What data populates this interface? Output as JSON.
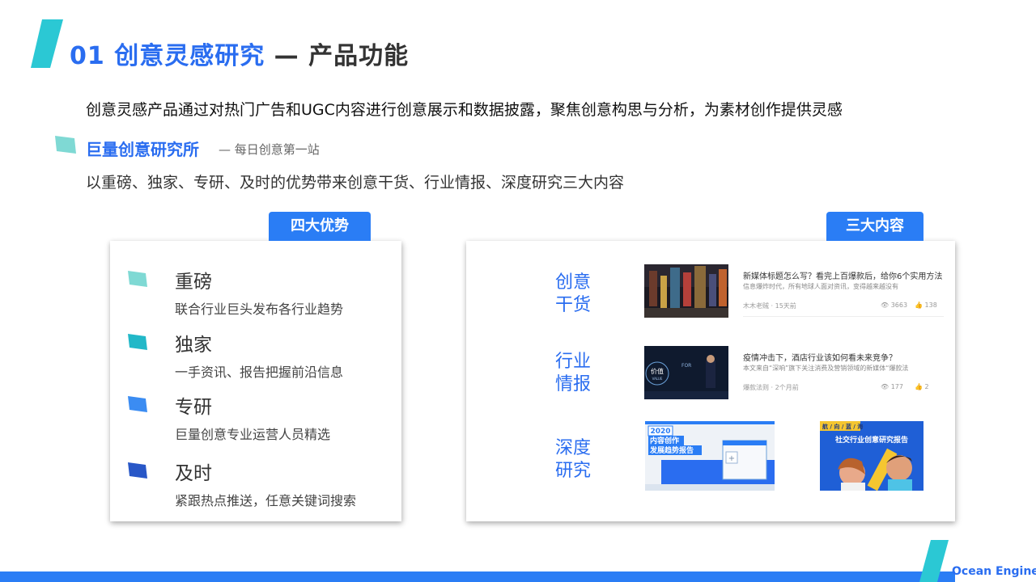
{
  "header": {
    "title_number": "01 创意灵感研究",
    "title_rest": " — 产品功能"
  },
  "intro": "创意灵感产品通过对热门广告和UGC内容进行创意展示和数据披露，聚焦创意构思与分析，为素材创作提供灵感",
  "lab": {
    "name": "巨量创意研究所",
    "tagline": "— 每日创意第一站",
    "description": "以重磅、独家、专研、及时的优势带来创意干货、行业情报、深度研究三大内容"
  },
  "advantages": {
    "tab": "四大优势",
    "items": [
      {
        "name": "重磅",
        "desc": "联合行业巨头发布各行业趋势",
        "color": "#7fd9d4"
      },
      {
        "name": "独家",
        "desc": "一手资讯、报告把握前沿信息",
        "color": "#22b8c8"
      },
      {
        "name": "专研",
        "desc": "巨量创意专业运营人员精选",
        "color": "#3b8cf2"
      },
      {
        "name": "及时",
        "desc": "紧跟热点推送，任意关键词搜索",
        "color": "#2857c7"
      }
    ]
  },
  "contents": {
    "tab": "三大内容",
    "categories": [
      {
        "line1": "创意",
        "line2": "干货"
      },
      {
        "line1": "行业",
        "line2": "情报"
      },
      {
        "line1": "深度",
        "line2": "研究"
      }
    ],
    "articles": [
      {
        "title": "新媒体标题怎么写？看完上百爆款后，给你6个实用方法",
        "snippet": "信息爆炸时代，所有地球人面对资讯，变得越来越没有",
        "meta": "木木老贼 · 15天前",
        "views": "3663",
        "likes": "138"
      },
      {
        "title": "疫情冲击下，酒店行业该如何看未来竞争？",
        "snippet": "本文来自“深响”旗下关注消费及营销领域的新媒体“爆款法",
        "meta": "爆款法则 · 2个月前",
        "views": "177",
        "likes": "2",
        "thumb_text_1": "价值",
        "thumb_text_2": "VALUE",
        "thumb_text_3": "FOR"
      }
    ],
    "reports": [
      {
        "year": "2020",
        "line1": "内容创作",
        "line2": "发展趋势报告"
      },
      {
        "top": "航 / 向 / 蓝 / 海",
        "title": "社交行业创意研究报告"
      }
    ]
  },
  "footer": {
    "brand": "Ocean Engine"
  },
  "colors": {
    "accent": "#2a6df0",
    "tab": "#2a7df5",
    "teal": "#33c6cf"
  }
}
